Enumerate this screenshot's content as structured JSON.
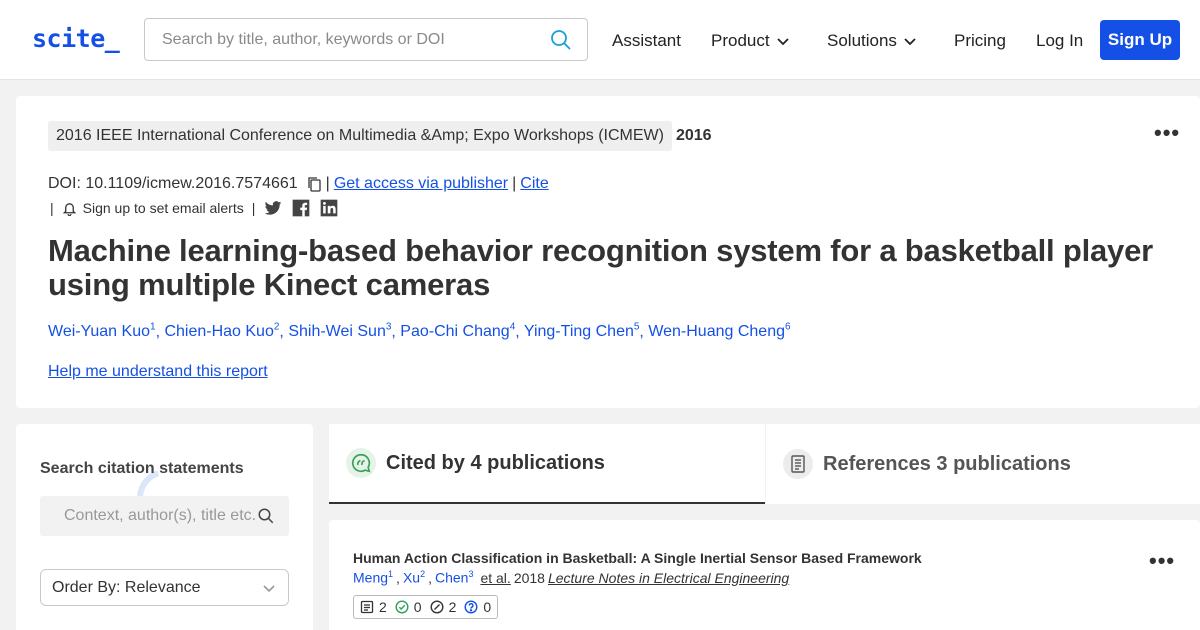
{
  "header": {
    "logo": "scite_",
    "search_placeholder": "Search by title, author, keywords or DOI",
    "nav": {
      "assistant": "Assistant",
      "product": "Product",
      "solutions": "Solutions",
      "pricing": "Pricing",
      "login": "Log In",
      "signup": "Sign Up"
    }
  },
  "paper": {
    "venue": "2016 IEEE International Conference on Multimedia &Amp; Expo Workshops (ICMEW)",
    "year": "2016",
    "doi": "DOI: 10.1109/icmew.2016.7574661",
    "sep1": "|",
    "get_access": "Get access via publisher",
    "sep2": "|",
    "cite": "Cite",
    "alert_sep_left": "|",
    "alert_text": "Sign up to set email alerts",
    "alert_sep_right": "|",
    "title": "Machine learning-based behavior recognition system for a basketball player using multiple Kinect cameras",
    "authors": [
      {
        "name": "Wei-Yuan Kuo",
        "sup": "1"
      },
      {
        "name": "Chien-Hao Kuo",
        "sup": "2"
      },
      {
        "name": "Shih-Wei Sun",
        "sup": "3"
      },
      {
        "name": "Pao-Chi Chang",
        "sup": "4"
      },
      {
        "name": "Ying-Ting Chen",
        "sup": "5"
      },
      {
        "name": "Wen-Huang Cheng",
        "sup": "6"
      }
    ],
    "help_link": "Help me understand this report"
  },
  "sidebar": {
    "search_label": "Search citation statements",
    "search_placeholder": "Context, author(s), title etc.",
    "order_by": "Order By: Relevance"
  },
  "tabs": {
    "cited": "Cited by 4 publications",
    "references": "References 3 publications"
  },
  "result": {
    "title": "Human Action Classification in Basketball: A Single Inertial Sensor Based Framework",
    "authors": [
      {
        "name": "Meng",
        "sup": "1"
      },
      {
        "name": "Xu",
        "sup": "2"
      },
      {
        "name": "Chen",
        "sup": "3"
      }
    ],
    "et_al": "et al.",
    "year": "2018",
    "journal": "Lecture Notes in Electrical Engineering",
    "tally": {
      "mentioning": "2",
      "supporting": "0",
      "contrasting": "2",
      "unclassified": "0"
    }
  },
  "colors": {
    "brand": "#1550e6",
    "supporting": "#2e9e5b",
    "cited_tab_icon": "#3aa05a"
  },
  "icons": [
    "search-icon",
    "chevron-down-icon",
    "copy-icon",
    "bell-icon",
    "twitter-icon",
    "facebook-icon",
    "linkedin-icon",
    "more-icon",
    "quote-bubble-icon",
    "document-icon",
    "loading-spinner-icon"
  ]
}
